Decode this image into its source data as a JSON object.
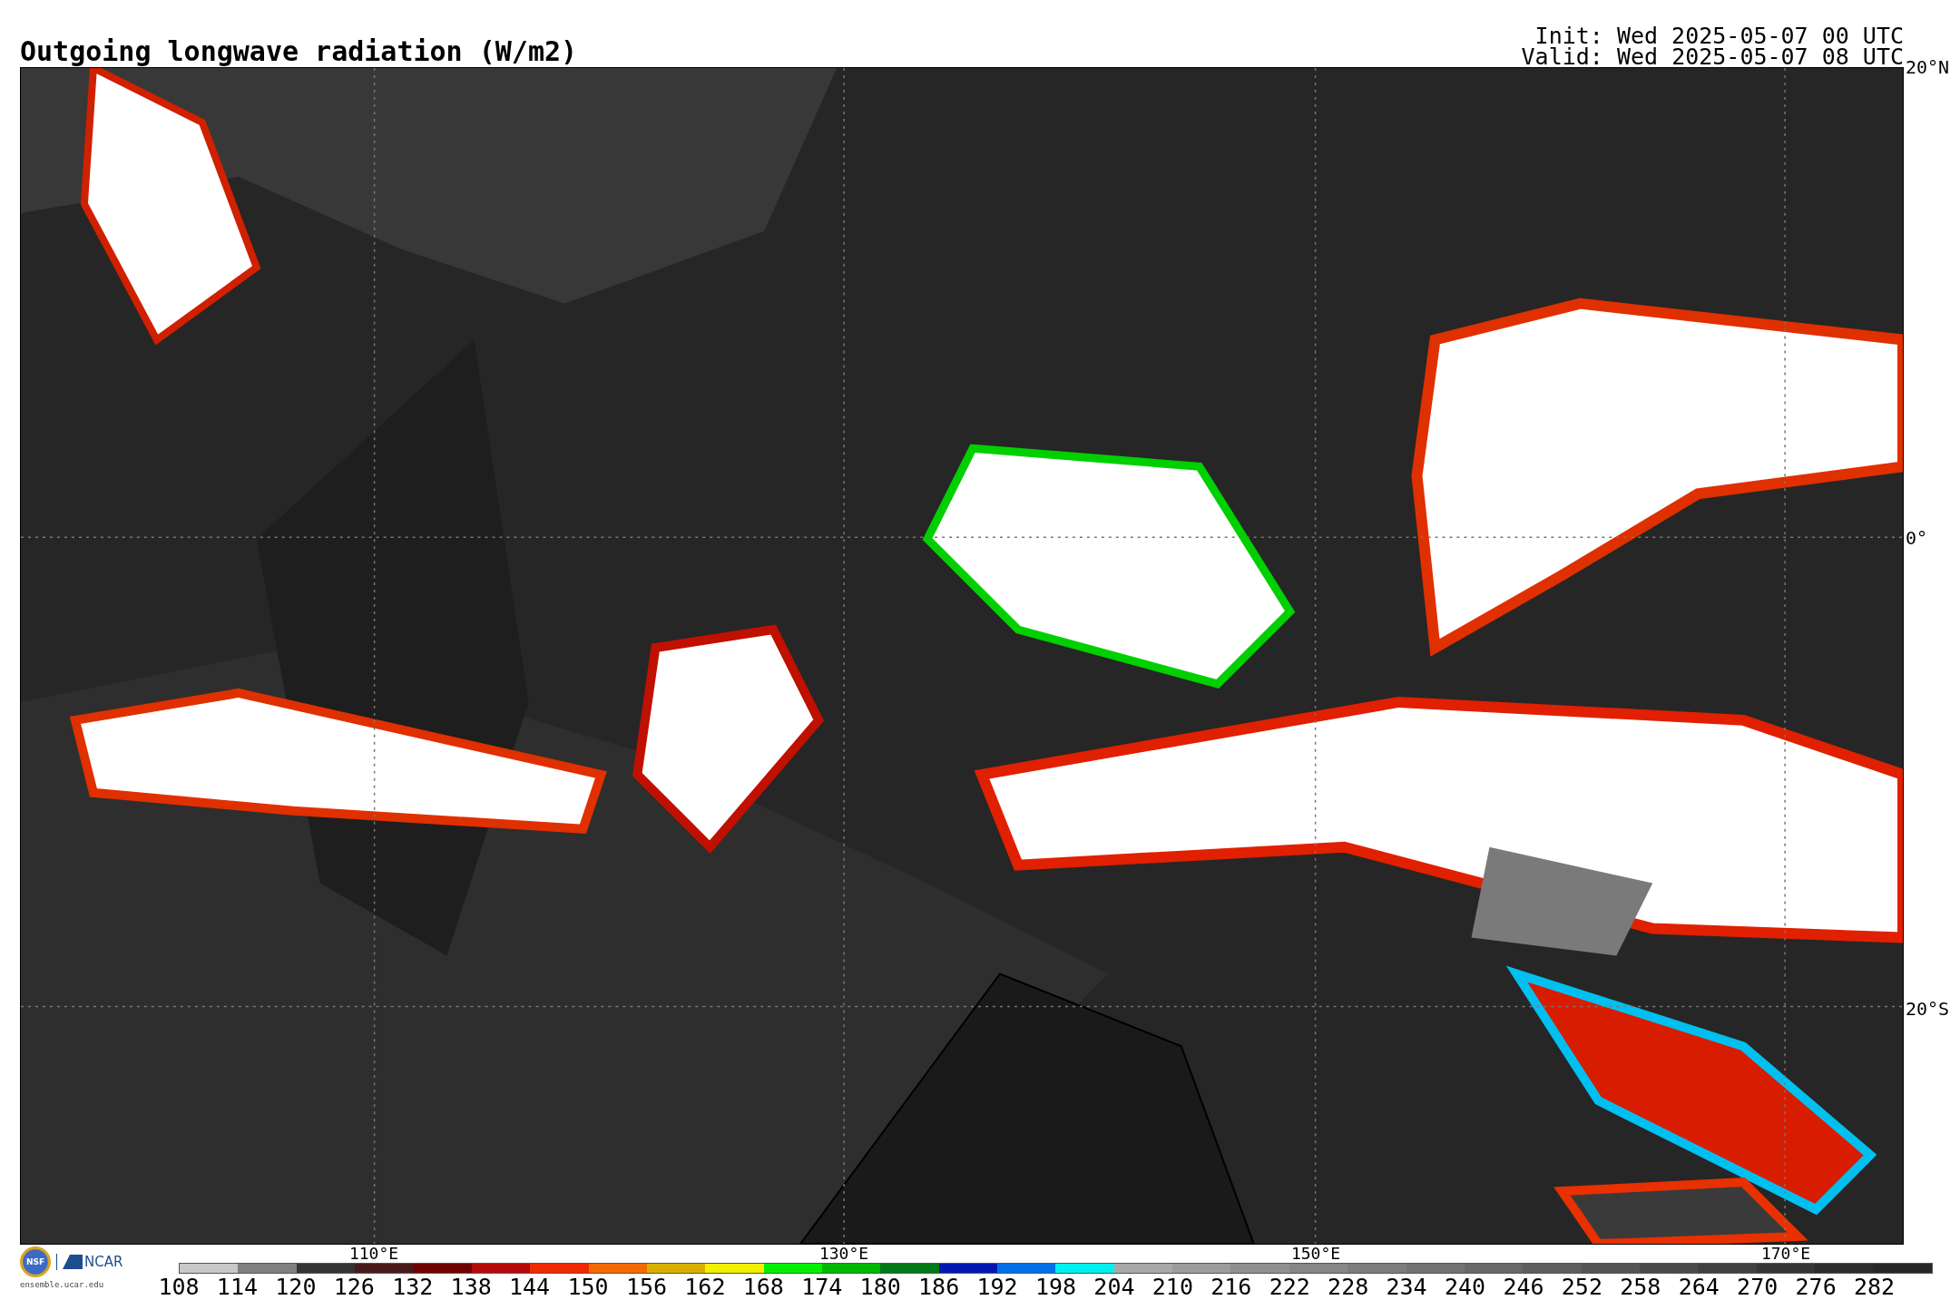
{
  "title": "Outgoing longwave radiation (W/m2)",
  "init": "Init: Wed 2025-05-07 00 UTC",
  "valid": "Valid: Wed 2025-05-07 08 UTC",
  "lat_labels": [
    "20°N",
    "0°",
    "20°S"
  ],
  "lon_labels": [
    "110°E",
    "130°E",
    "150°E",
    "170°E"
  ],
  "logos": {
    "nsf": "NSF",
    "ncar": "NCAR",
    "site": "ensemble.ucar.edu"
  },
  "colorbar": {
    "bins": [
      {
        "color": "#c8c8c8"
      },
      {
        "color": "#808080"
      },
      {
        "color": "#343434"
      },
      {
        "color": "#4a1a1a"
      },
      {
        "color": "#6e0000"
      },
      {
        "color": "#b40a0a"
      },
      {
        "color": "#f02800"
      },
      {
        "color": "#f26b00"
      },
      {
        "color": "#d9b000"
      },
      {
        "color": "#f0f000"
      },
      {
        "color": "#00f000"
      },
      {
        "color": "#00b800"
      },
      {
        "color": "#007a18"
      },
      {
        "color": "#0018b0"
      },
      {
        "color": "#0070e8"
      },
      {
        "color": "#00f0f0"
      },
      {
        "color": "#a8a8a8"
      },
      {
        "color": "#9c9c9c"
      },
      {
        "color": "#909090"
      },
      {
        "color": "#868686"
      },
      {
        "color": "#7c7c7c"
      },
      {
        "color": "#727272"
      },
      {
        "color": "#686868"
      },
      {
        "color": "#5e5e5e"
      },
      {
        "color": "#545454"
      },
      {
        "color": "#4a4a4a"
      },
      {
        "color": "#404040"
      },
      {
        "color": "#363636"
      },
      {
        "color": "#2c2c2c"
      },
      {
        "color": "#262626"
      }
    ],
    "labels": [
      "108",
      "114",
      "120",
      "126",
      "132",
      "138",
      "144",
      "150",
      "156",
      "162",
      "168",
      "174",
      "180",
      "186",
      "192",
      "198",
      "204",
      "210",
      "216",
      "222",
      "228",
      "234",
      "240",
      "246",
      "252",
      "258",
      "264",
      "270",
      "276",
      "282"
    ]
  }
}
